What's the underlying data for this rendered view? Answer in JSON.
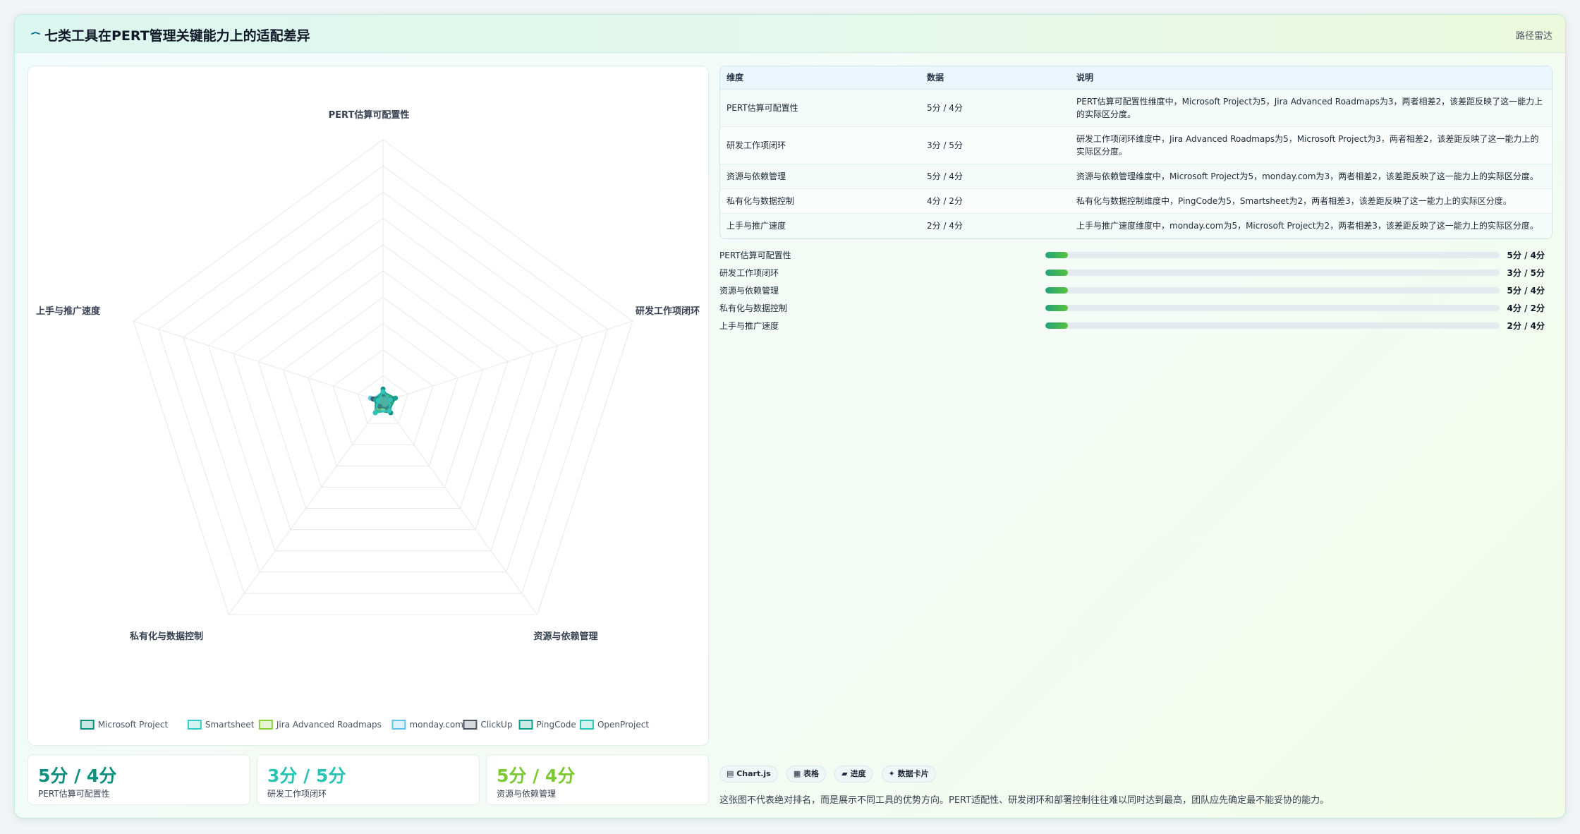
{
  "header": {
    "title": "七类工具在PERT管理关键能力上的适配差异",
    "tag": "路径雷达"
  },
  "chart_data": {
    "type": "radar",
    "axes": [
      "PERT估算可配置性",
      "研发工作项闭环",
      "资源与依赖管理",
      "私有化与数据控制",
      "上手与推广速度"
    ],
    "max": 100,
    "rings": 10,
    "series": [
      {
        "name": "Microsoft Project",
        "values": [
          5,
          3,
          5,
          4,
          2
        ],
        "color": "#0f8f7e"
      },
      {
        "name": "Smartsheet",
        "values": [
          4,
          3,
          4,
          2,
          4
        ],
        "color": "#38c9c9"
      },
      {
        "name": "Jira Advanced Roadmaps",
        "values": [
          3,
          5,
          3,
          3,
          3
        ],
        "color": "#8ccf3a"
      },
      {
        "name": "monday.com",
        "values": [
          3,
          3,
          3,
          2,
          5
        ],
        "color": "#5fc4e8"
      },
      {
        "name": "ClickUp",
        "values": [
          3,
          4,
          3,
          2,
          4
        ],
        "color": "#4b5563"
      },
      {
        "name": "PingCode",
        "values": [
          4,
          5,
          4,
          5,
          3
        ],
        "color": "#14a08c"
      },
      {
        "name": "OpenProject",
        "values": [
          4,
          3,
          4,
          5,
          2
        ],
        "color": "#2ec4b6"
      }
    ]
  },
  "stats": [
    {
      "value": "5分 / 4分",
      "label": "PERT估算可配置性",
      "color": "#0f8f7e"
    },
    {
      "value": "3分 / 5分",
      "label": "研发工作项闭环",
      "color": "#2bc3b3"
    },
    {
      "value": "5分 / 4分",
      "label": "资源与依赖管理",
      "color": "#7cc934"
    }
  ],
  "table": {
    "headers": [
      "维度",
      "数据",
      "说明"
    ],
    "rows": [
      {
        "dimension": "PERT估算可配置性",
        "data": "5分 / 4分",
        "note": "PERT估算可配置性维度中，Microsoft Project为5，Jira Advanced Roadmaps为3，两者相差2，该差距反映了这一能力上的实际区分度。"
      },
      {
        "dimension": "研发工作项闭环",
        "data": "3分 / 5分",
        "note": "研发工作项闭环维度中，Jira Advanced Roadmaps为5，Microsoft Project为3，两者相差2，该差距反映了这一能力上的实际区分度。"
      },
      {
        "dimension": "资源与依赖管理",
        "data": "5分 / 4分",
        "note": "资源与依赖管理维度中，Microsoft Project为5，monday.com为3，两者相差2，该差距反映了这一能力上的实际区分度。"
      },
      {
        "dimension": "私有化与数据控制",
        "data": "4分 / 2分",
        "note": "私有化与数据控制维度中，PingCode为5，Smartsheet为2，两者相差3，该差距反映了这一能力上的实际区分度。"
      },
      {
        "dimension": "上手与推广速度",
        "data": "2分 / 4分",
        "note": "上手与推广速度维度中，monday.com为5，Microsoft Project为2，两者相差3，该差距反映了这一能力上的实际区分度。"
      }
    ]
  },
  "progress": [
    {
      "label": "PERT估算可配置性",
      "value": "5分 / 4分",
      "fill": 0.05
    },
    {
      "label": "研发工作项闭环",
      "value": "3分 / 5分",
      "fill": 0.05
    },
    {
      "label": "资源与依赖管理",
      "value": "5分 / 4分",
      "fill": 0.05
    },
    {
      "label": "私有化与数据控制",
      "value": "4分 / 2分",
      "fill": 0.05
    },
    {
      "label": "上手与推广速度",
      "value": "2分 / 4分",
      "fill": 0.05
    }
  ],
  "chips": [
    "▤ Chart.js",
    "▦ 表格",
    "▰ 进度",
    "✦ 数据卡片"
  ],
  "note": "这张图不代表绝对排名，而是展示不同工具的优势方向。PERT适配性、研发闭环和部署控制往往难以同时达到最高，团队应先确定最不能妥协的能力。"
}
